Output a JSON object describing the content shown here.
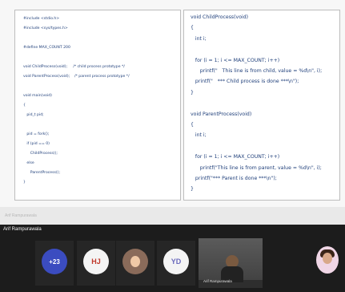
{
  "slide": {
    "left_code": [
      "#include <stdio.h>",
      "#include <sys/types.h>",
      "",
      "#define MAX_COUNT 200",
      "",
      "void ChildProcess(void);     /* child process prototype */",
      "void ParentProcess(void);    /* parent process prototype */",
      "",
      "void main(void)",
      "{",
      "   pid_t pid;",
      "",
      "   pid = fork();",
      "   if (pid == 0)",
      "      ChildProcess();",
      "   else",
      "      ParentProcess();",
      "}"
    ],
    "right_code": [
      "void ChildProcess(void)",
      "{",
      "   int i;",
      "",
      "   for (i = 1; i <= MAX_COUNT; i++)",
      "      printf(\"   This line is from child, value = %d\\n\", i);",
      "   printf(\"   *** Child process is done ***\\n\");",
      "}",
      "",
      "void ParentProcess(void)",
      "{",
      "   int i;",
      "",
      "   for (i = 1; i <= MAX_COUNT; i++)",
      "      printf(\"This line is from parent, value = %d\\n\", i);",
      "   printf(\"*** Parent is done ***\\n\");",
      "}"
    ]
  },
  "strip": {
    "label": "Arif Rampurawala"
  },
  "meeting": {
    "host_name": "Arif Rampurawala",
    "participants": {
      "more_count": "+23",
      "hj_initials": "HJ",
      "yd_initials": "YD",
      "video_name": "Arif Rampurawala"
    },
    "colors": {
      "more": "#3b4cc0",
      "hj_bg": "#f4f4f4",
      "hj_text": "#c0392b",
      "yd_bg": "#f4f4f4",
      "yd_text": "#6b6bbd",
      "avatar2_bg": "#8a6b5a"
    }
  }
}
